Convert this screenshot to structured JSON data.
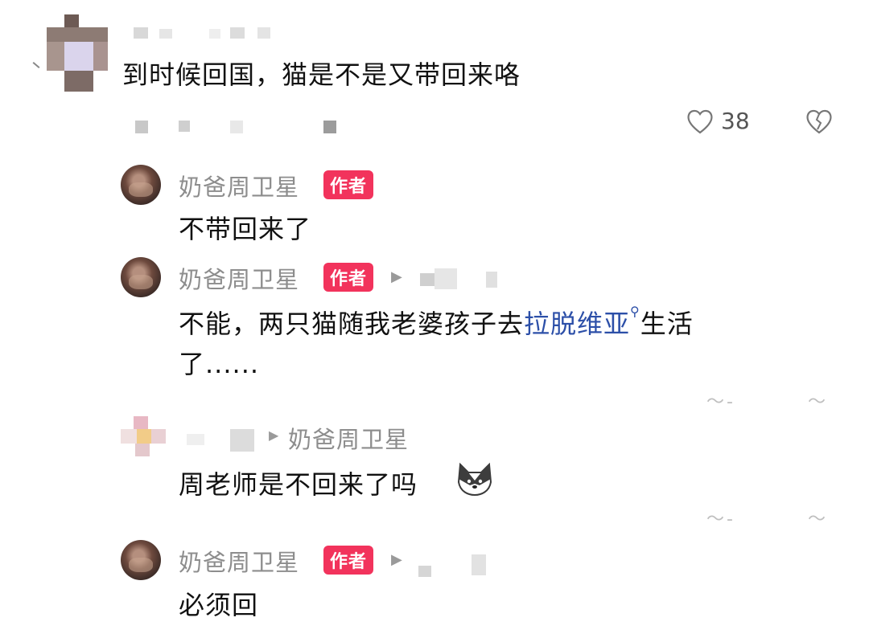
{
  "top_comment": {
    "text": "到时候回国，猫是不是又带回来咯",
    "like_count": "38",
    "colors": {
      "heart": "#777777"
    }
  },
  "author": {
    "name": "奶爸周卫星",
    "badge": "作者",
    "badge_color": "#f2335c"
  },
  "replies": [
    {
      "text": "不带回来了"
    },
    {
      "text_before": "不能，两只猫随我老婆孩子去",
      "link": "拉脱维亚",
      "text_after": "生活",
      "text_line2": "了......"
    },
    {
      "reply_to": "奶爸周卫星",
      "text": "周老师是不回来了吗"
    },
    {
      "text": "必须回"
    }
  ],
  "icons": [
    "heart-outline-icon",
    "broken-heart-icon",
    "search-magnifier-icon",
    "reply-arrow-icon",
    "husky-emoji"
  ]
}
